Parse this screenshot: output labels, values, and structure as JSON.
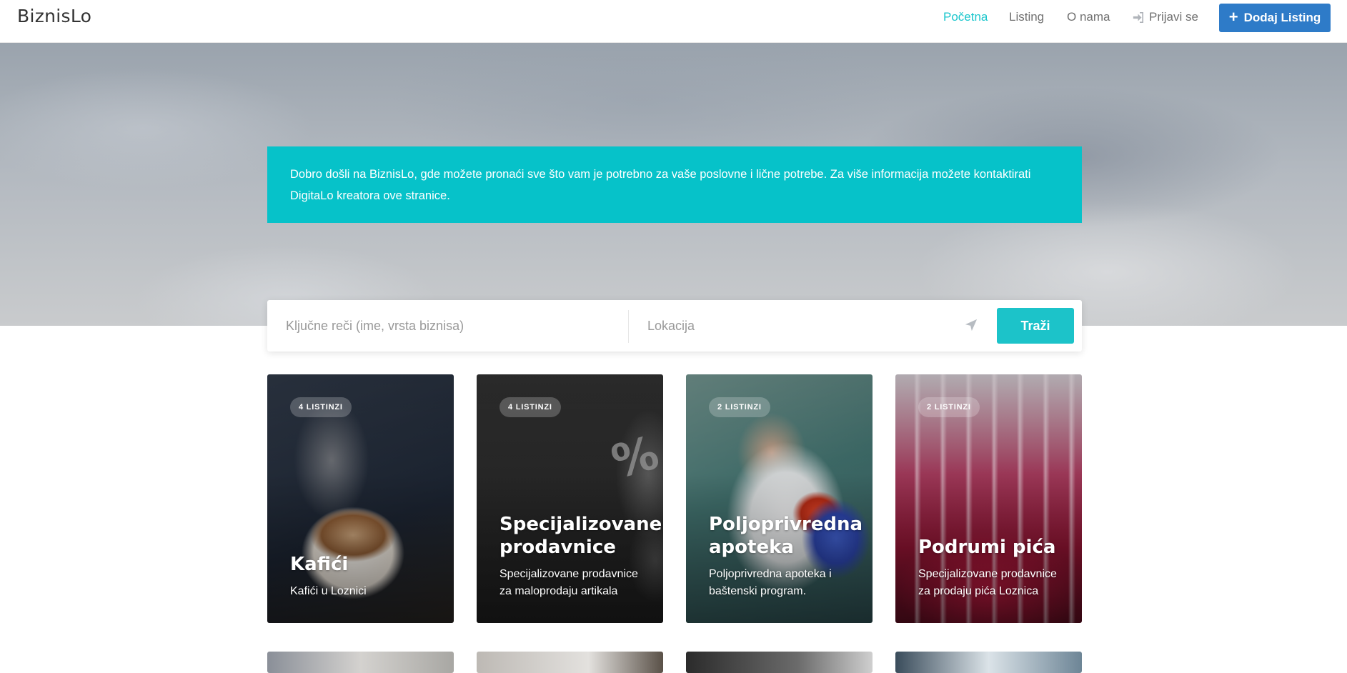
{
  "header": {
    "logo": "BiznisLo",
    "nav": [
      {
        "label": "Početna",
        "active": true
      },
      {
        "label": "Listing",
        "active": false
      },
      {
        "label": "O nama",
        "active": false
      }
    ],
    "login_label": "Prijavi se",
    "add_button_label": "Dodaj Listing"
  },
  "hero": {
    "welcome_text": "Dobro došli na BiznisLo, gde možete pronaći sve što vam je potrebno za vaše poslovne i lične potrebe. Za više informacija možete kontaktirati DigitaLo kreatora ove stranice."
  },
  "search": {
    "keywords_placeholder": "Ključne reči (ime, vrsta biznisa)",
    "location_placeholder": "Lokacija",
    "button_label": "Traži"
  },
  "categories": [
    {
      "badge": "4 LISTINZI",
      "title": "Kafići",
      "subtitle": "Kafići u Loznici"
    },
    {
      "badge": "4 LISTINZI",
      "title": "Specijalizovane prodavnice",
      "subtitle": "Specijalizovane prodavnice za maloprodaju artikala"
    },
    {
      "badge": "2 LISTINZI",
      "title": "Poljoprivredna apoteka",
      "subtitle": "Poljoprivredna apoteka i baštenski program."
    },
    {
      "badge": "2 LISTINZI",
      "title": "Podrumi pića",
      "subtitle": "Specijalizovane prodavnice za prodaju pića Loznica"
    }
  ],
  "colors": {
    "accent": "#06c2c9",
    "primary_button": "#2e7bc8",
    "nav_active": "#1ac6cc"
  },
  "icons": {
    "login": "sign-in-icon",
    "add": "plus-icon",
    "locate": "location-arrow-icon"
  }
}
